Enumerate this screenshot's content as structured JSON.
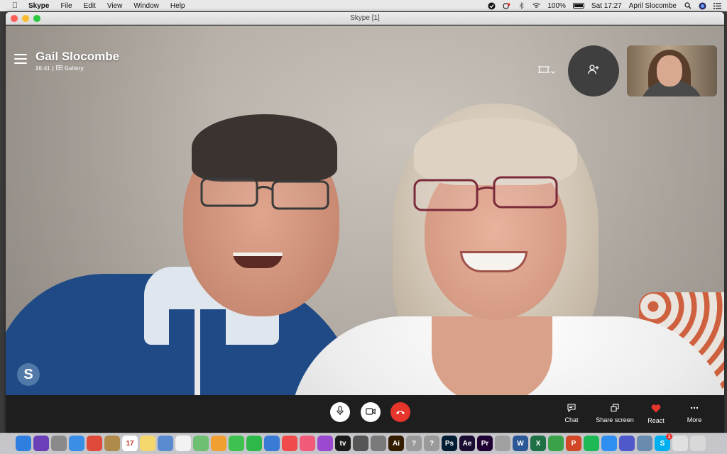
{
  "menubar": {
    "app": "Skype",
    "items": [
      "File",
      "Edit",
      "View",
      "Window",
      "Help"
    ],
    "battery": "100%",
    "clock": "Sat 17:27",
    "user": "April Slocombe"
  },
  "window": {
    "title": "Skype [1]"
  },
  "call": {
    "caller_name": "Gail Slocombe",
    "duration": "26:41",
    "separator": "|",
    "view_mode": "Gallery"
  },
  "toolbar": {
    "chat_label": "Chat",
    "share_label": "Share screen",
    "react_label": "React",
    "more_label": "More"
  },
  "watermark": {
    "letter": "S"
  },
  "colors": {
    "hangup": "#e8352c",
    "react_heart": "#e8352c",
    "callbar": "#1e1e1e"
  },
  "dock": {
    "apps": [
      {
        "name": "finder-icon",
        "color": "#2f7fe0",
        "glyph": ""
      },
      {
        "name": "siri-icon",
        "color": "#6b3fb8",
        "glyph": ""
      },
      {
        "name": "launchpad-icon",
        "color": "#8a8a8a",
        "glyph": ""
      },
      {
        "name": "safari-icon",
        "color": "#3a8ee6",
        "glyph": ""
      },
      {
        "name": "chrome-icon",
        "color": "#e04a3a",
        "glyph": ""
      },
      {
        "name": "notebook-icon",
        "color": "#b08a4a",
        "glyph": ""
      },
      {
        "name": "calendar-icon",
        "color": "#ffffff",
        "glyph": "17"
      },
      {
        "name": "notes-icon",
        "color": "#f5d76e",
        "glyph": ""
      },
      {
        "name": "preview-icon",
        "color": "#5a8ad0",
        "glyph": ""
      },
      {
        "name": "reminders-icon",
        "color": "#f2f2f2",
        "glyph": ""
      },
      {
        "name": "maps-icon",
        "color": "#6fbf73",
        "glyph": ""
      },
      {
        "name": "photos-icon",
        "color": "#f0a030",
        "glyph": ""
      },
      {
        "name": "messages-icon",
        "color": "#3ec14f",
        "glyph": ""
      },
      {
        "name": "facetime-icon",
        "color": "#2fb84a",
        "glyph": ""
      },
      {
        "name": "keynote-icon",
        "color": "#3a7bd5",
        "glyph": ""
      },
      {
        "name": "news-icon",
        "color": "#f04a4a",
        "glyph": ""
      },
      {
        "name": "music-icon",
        "color": "#f25a7a",
        "glyph": ""
      },
      {
        "name": "podcasts-icon",
        "color": "#9b4ad0",
        "glyph": ""
      },
      {
        "name": "apple-tv-icon",
        "color": "#1a1a1a",
        "glyph": "tv"
      },
      {
        "name": "scanner-icon",
        "color": "#555555",
        "glyph": ""
      },
      {
        "name": "system-preferences-icon",
        "color": "#7a7a7a",
        "glyph": ""
      },
      {
        "name": "illustrator-icon",
        "color": "#331c00",
        "glyph": "Ai"
      },
      {
        "name": "help-icon",
        "color": "#9a9a9a",
        "glyph": "?"
      },
      {
        "name": "help-icon-2",
        "color": "#9a9a9a",
        "glyph": "?"
      },
      {
        "name": "photoshop-icon",
        "color": "#001d34",
        "glyph": "Ps"
      },
      {
        "name": "after-effects-icon",
        "color": "#1a0b33",
        "glyph": "Ae"
      },
      {
        "name": "premiere-icon",
        "color": "#1f0033",
        "glyph": "Pr"
      },
      {
        "name": "archive-icon",
        "color": "#a0a0a0",
        "glyph": ""
      },
      {
        "name": "word-icon",
        "color": "#2b5797",
        "glyph": "W"
      },
      {
        "name": "excel-icon",
        "color": "#1e7145",
        "glyph": "X"
      },
      {
        "name": "numbers-icon",
        "color": "#3aa34a",
        "glyph": ""
      },
      {
        "name": "powerpoint-icon",
        "color": "#d24726",
        "glyph": "P"
      },
      {
        "name": "spotify-icon",
        "color": "#1db954",
        "glyph": ""
      },
      {
        "name": "app-store-icon",
        "color": "#2f8ff0",
        "glyph": ""
      },
      {
        "name": "teams-icon",
        "color": "#5059c9",
        "glyph": ""
      },
      {
        "name": "image-capture-icon",
        "color": "#6a8ab0",
        "glyph": ""
      },
      {
        "name": "skype-icon",
        "color": "#00aff0",
        "glyph": "S"
      },
      {
        "name": "keychain-icon",
        "color": "#e0e0e0",
        "glyph": ""
      },
      {
        "name": "trash-icon",
        "color": "#d8d8d8",
        "glyph": ""
      }
    ],
    "skype_badge": "1"
  }
}
